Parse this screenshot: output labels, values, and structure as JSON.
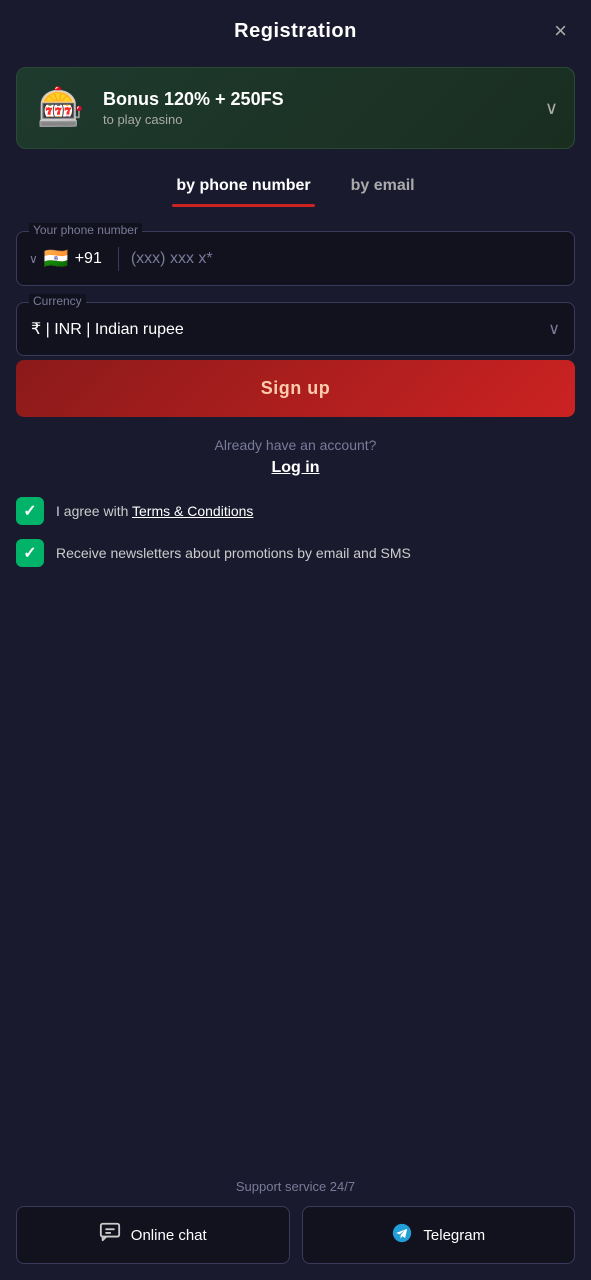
{
  "header": {
    "title": "Registration",
    "close_label": "×"
  },
  "bonus": {
    "icon": "🎰",
    "title": "Bonus 120% + 250FS",
    "subtitle": "to play casino",
    "chevron": "∨"
  },
  "tabs": [
    {
      "id": "phone",
      "label": "by phone number",
      "active": true
    },
    {
      "id": "email",
      "label": "by email",
      "active": false
    }
  ],
  "form": {
    "phone_label": "Your phone number",
    "country_code": "+91",
    "phone_placeholder": "(xxx) xxx x*",
    "currency_label": "Currency",
    "currency_value": "₹ | INR | Indian rupee",
    "signup_label": "Sign up"
  },
  "login": {
    "already_text": "Already have an account?",
    "login_label": "Log in"
  },
  "checkboxes": [
    {
      "id": "terms",
      "label_before": "I agree with ",
      "link_text": "Terms & Conditions",
      "label_after": "",
      "checked": true
    },
    {
      "id": "newsletter",
      "label_before": "Receive newsletters about promotions by email and SMS",
      "link_text": "",
      "label_after": "",
      "checked": true
    }
  ],
  "support": {
    "label": "Support service 24/7",
    "buttons": [
      {
        "id": "chat",
        "label": "Online chat",
        "icon": "chat"
      },
      {
        "id": "telegram",
        "label": "Telegram",
        "icon": "telegram"
      }
    ]
  }
}
